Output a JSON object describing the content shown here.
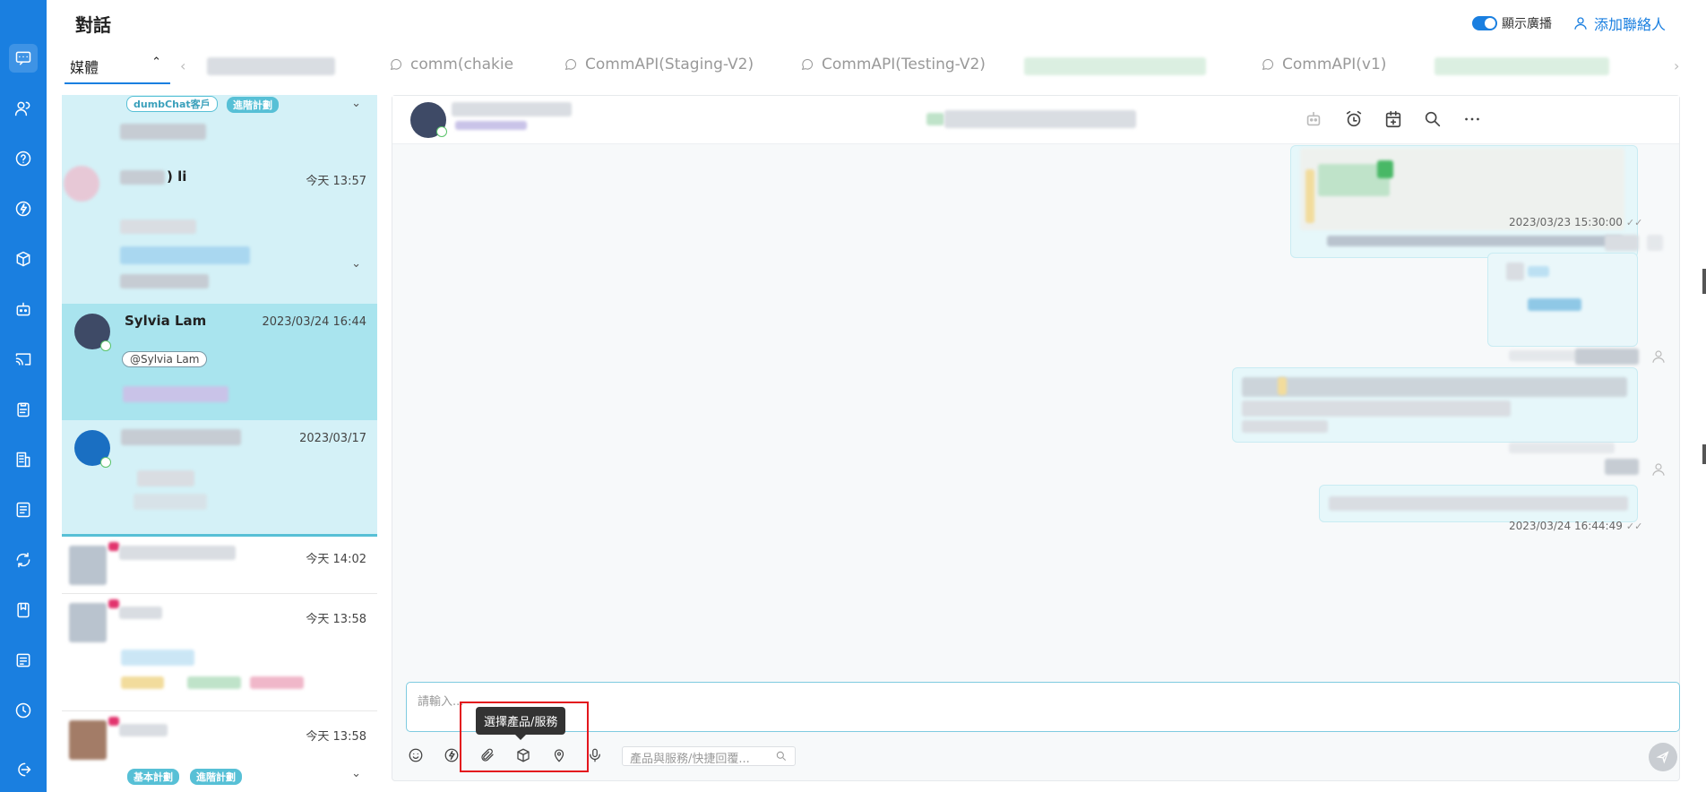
{
  "header": {
    "title": "對話",
    "broadcast_label": "顯示廣播",
    "add_contact_label": "添加聯絡人"
  },
  "media_tab": {
    "label": "媒體"
  },
  "channels": [
    {
      "label": "comm(chakie"
    },
    {
      "label": "CommAPI(Staging-V2)"
    },
    {
      "label": "CommAPI(Testing-V2)"
    },
    {
      "label": "CommAPI(v1)"
    }
  ],
  "conversations": {
    "first": {
      "tag_dumbchat": "dumbChat客戶",
      "tag_advanced": "進階計劃"
    },
    "second": {
      "name_suffix": ") li",
      "time": "今天 13:57"
    },
    "selected": {
      "name": "Sylvia Lam",
      "time": "2023/03/24 16:44",
      "mention_tag": "@Sylvia Lam"
    },
    "fourth": {
      "time": "2023/03/17"
    },
    "fifth": {
      "time": "今天 14:02"
    },
    "sixth": {
      "time": "今天 13:58"
    },
    "seventh": {
      "time": "今天 13:58",
      "tag_basic": "基本計劃",
      "tag_advanced": "進階計劃"
    }
  },
  "chat": {
    "stamp_1": "2023/03/23 15:30:00",
    "stamp_2": "2023/03/24 16:44:49",
    "tick": "✓✓"
  },
  "composer": {
    "placeholder": "請輸入...",
    "quick_reply_placeholder": "產品與服務/快捷回覆...",
    "tooltip": "選擇產品/服務"
  },
  "accent_color": "#1a7fe0",
  "highlight_color": "#e3161d"
}
